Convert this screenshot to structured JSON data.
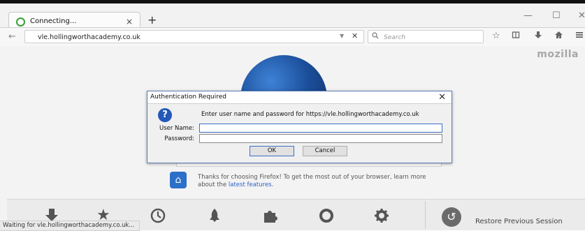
{
  "browser": {
    "tab": {
      "title": "Connecting...",
      "close": "×"
    },
    "new_tab": "+",
    "window_controls": {
      "minimize": "—",
      "maximize": "☐",
      "close": "✕"
    },
    "nav": {
      "back": "←",
      "url": "vle.hollingworthacademy.co.uk",
      "url_dropdown": "▼",
      "url_stop": "✕",
      "search_placeholder": "Search"
    },
    "brand": "mozilla",
    "status": "Waiting for vle.hollingworthacademy.co.uk..."
  },
  "start_page": {
    "promo_text": "Thanks for choosing Firefox! To get the most out of your browser, learn more about the",
    "promo_link": "latest features",
    "promo_end": ".",
    "restore_label": "Restore Previous Session"
  },
  "dialog": {
    "title": "Authentication Required",
    "close": "✕",
    "message": "Enter user name and password for https://vle.hollingworthacademy.co.uk",
    "username_label": "User Name:",
    "username_value": "",
    "password_label": "Password:",
    "password_value": "",
    "ok_label": "OK",
    "cancel_label": "Cancel"
  },
  "colors": {
    "accent": "#2b6fc9",
    "dialog_border": "#5c7fb5",
    "loading_spinner": "#3aa03a"
  }
}
